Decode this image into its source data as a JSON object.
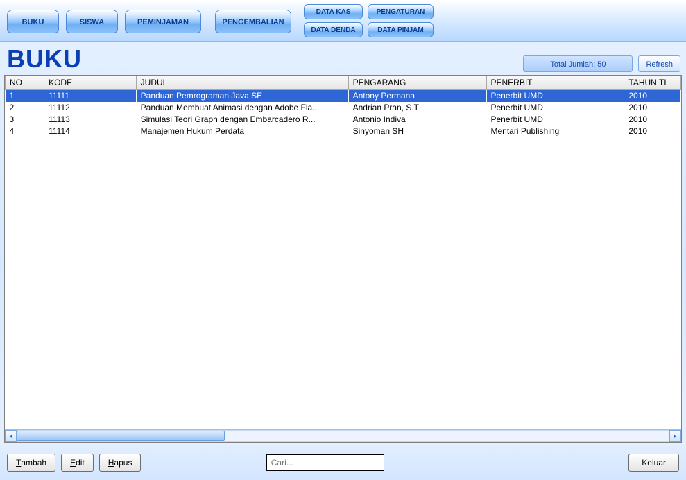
{
  "menu": {
    "buku": "BUKU",
    "siswa": "SISWA",
    "peminjaman": "PEMINJAMAN",
    "pengembalian": "PENGEMBALIAN",
    "datakas": "DATA KAS",
    "datadenda": "DATA DENDA",
    "pengaturan": "PENGATURAN",
    "datapinjam": "DATA PINJAM"
  },
  "title": "BUKU",
  "status": {
    "total_label": "Total Jumlah: 50",
    "refresh": "Refresh"
  },
  "columns": {
    "no": "NO",
    "kode": "KODE",
    "judul": "JUDUL",
    "pengarang": "PENGARANG",
    "penerbit": "PENERBIT",
    "tahun": "TAHUN TI"
  },
  "rows": [
    {
      "no": "1",
      "kode": "11111",
      "judul": "Panduan Pemrograman Java SE",
      "pengarang": "Antony Permana",
      "penerbit": "Penerbit UMD",
      "tahun": "2010"
    },
    {
      "no": "2",
      "kode": "11112",
      "judul": "Panduan Membuat Animasi dengan Adobe Fla...",
      "pengarang": "Andrian Pran, S.T",
      "penerbit": "Penerbit UMD",
      "tahun": "2010"
    },
    {
      "no": "3",
      "kode": "11113",
      "judul": "Simulasi Teori Graph dengan Embarcadero R...",
      "pengarang": "Antonio Indiva",
      "penerbit": "Penerbit UMD",
      "tahun": "2010"
    },
    {
      "no": "4",
      "kode": "11114",
      "judul": "Manajemen Hukum Perdata",
      "pengarang": "Sinyoman SH",
      "penerbit": "Mentari Publishing",
      "tahun": "2010"
    }
  ],
  "footer": {
    "tambah": "ambah",
    "tambah_m": "T",
    "edit": "dit",
    "edit_m": "E",
    "hapus": "apus",
    "hapus_m": "H",
    "keluar": "Keluar",
    "search_placeholder": "Cari..."
  }
}
